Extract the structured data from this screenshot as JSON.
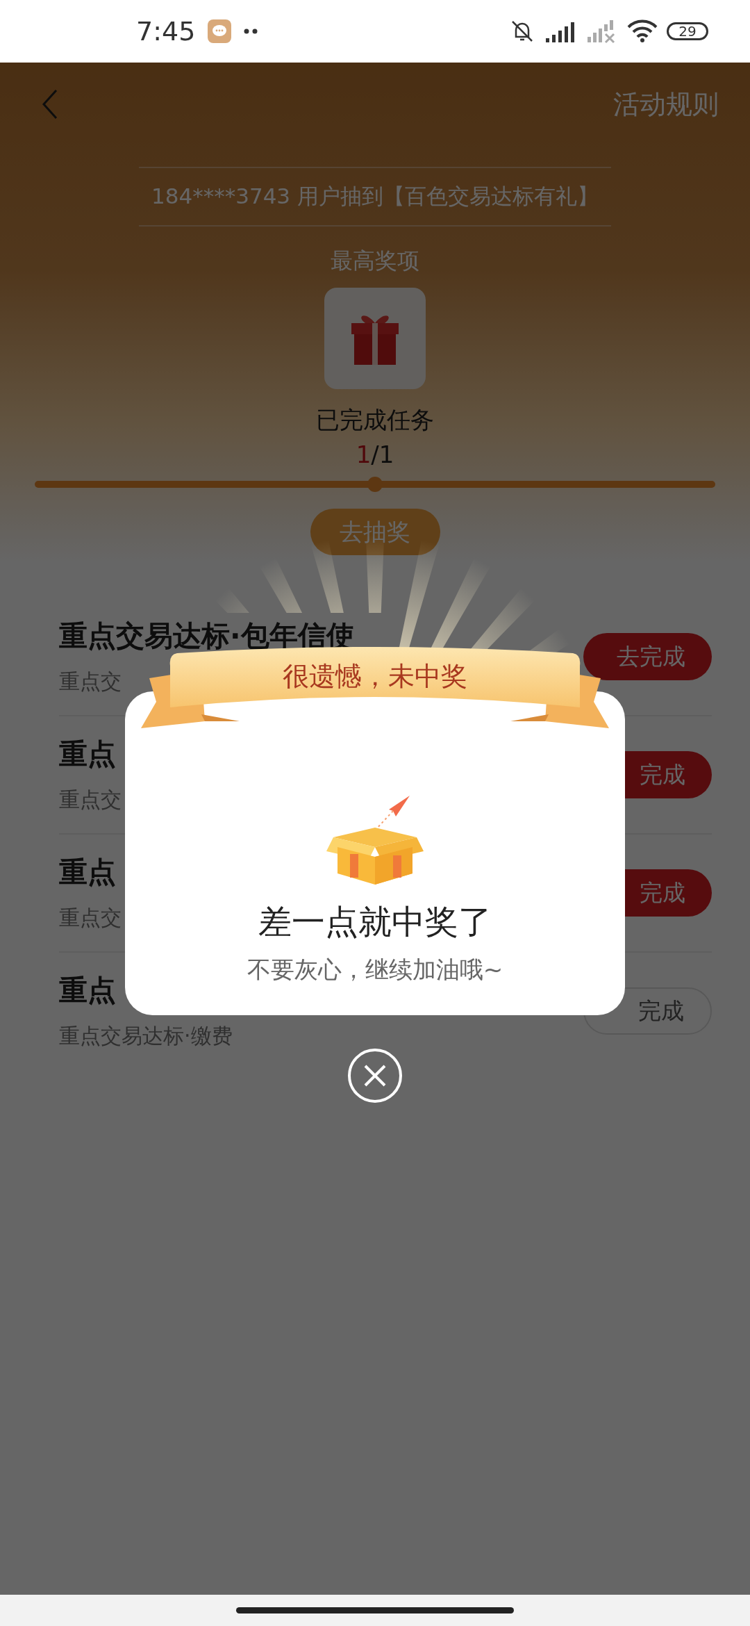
{
  "status_bar": {
    "time": "7:45",
    "battery": "29"
  },
  "header": {
    "rules_link": "活动规则"
  },
  "ticker": "184****3743 用户抽到【百色交易达标有礼】",
  "top_prize": {
    "label": "最高奖项"
  },
  "progress": {
    "label": "已完成任务",
    "done": "1",
    "total": "/1",
    "level": 0.5
  },
  "draw_button": "去抽奖",
  "tasks": [
    {
      "title": "重点交易达标·包年信使",
      "subtitle": "重点交",
      "button": "去完成",
      "kind": "filled"
    },
    {
      "title": "重点",
      "subtitle": "重点交",
      "button": "完成",
      "kind": "filled"
    },
    {
      "title": "重点",
      "subtitle": "重点交",
      "button": "完成",
      "kind": "filled"
    },
    {
      "title": "重点",
      "subtitle": "重点交易达标·缴费",
      "button": "完成",
      "kind": "outline"
    }
  ],
  "dialog": {
    "banner": "很遗憾，未中奖",
    "title": "差一点就中奖了",
    "message": "不要灰心，继续加油哦~"
  }
}
